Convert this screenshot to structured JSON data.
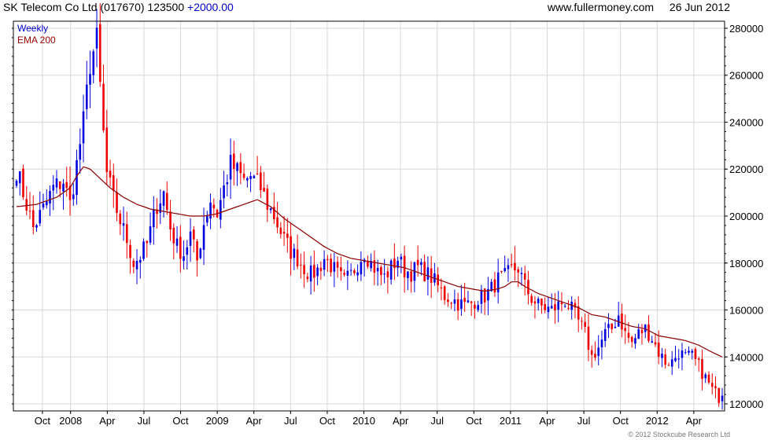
{
  "header": {
    "symbol": "SK Telecom Co Ltd (017670) 123500",
    "change": "+2000.00",
    "site": "www.fullermoney.com",
    "date": "26 Jun 2012"
  },
  "legend": {
    "series1": "Weekly",
    "series2": "EMA 200"
  },
  "copyright": "© 2012 Stockcube Research Ltd",
  "colors": {
    "up": "#0000dd",
    "down": "#ee0000",
    "ema": "#8b0000",
    "grid": "#d8d8d8"
  },
  "chart_data": {
    "type": "candlestick",
    "title": "SK Telecom Co Ltd (017670) 123500 +2000.00",
    "y_ticks": [
      "120000",
      "140000",
      "160000",
      "180000",
      "200000",
      "220000",
      "240000",
      "260000",
      "280000"
    ],
    "x_ticks": [
      "Oct",
      "2008",
      "Apr",
      "Jul",
      "Oct",
      "2009",
      "Apr",
      "Jul",
      "Oct",
      "2010",
      "Apr",
      "Jul",
      "Oct",
      "2011",
      "Apr",
      "Jul",
      "Oct",
      "2012",
      "Apr"
    ],
    "ylim": [
      117000,
      283000
    ],
    "grid": true,
    "legend_position": "top-left",
    "series": [
      {
        "name": "Weekly",
        "style": "candles",
        "keypoints_close": [
          [
            0,
            220000
          ],
          [
            3,
            205000
          ],
          [
            5,
            195000
          ],
          [
            8,
            203000
          ],
          [
            11,
            212000
          ],
          [
            14,
            215000
          ],
          [
            16,
            205000
          ],
          [
            18,
            222000
          ],
          [
            20,
            240000
          ],
          [
            22,
            265000
          ],
          [
            24,
            275000
          ],
          [
            26,
            235000
          ],
          [
            27,
            218000
          ],
          [
            29,
            207000
          ],
          [
            31,
            198000
          ],
          [
            33,
            190000
          ],
          [
            35,
            180000
          ],
          [
            37,
            183000
          ],
          [
            39,
            188000
          ],
          [
            42,
            205000
          ],
          [
            44,
            210000
          ],
          [
            46,
            195000
          ],
          [
            48,
            187000
          ],
          [
            50,
            184000
          ],
          [
            52,
            192000
          ],
          [
            54,
            181000
          ],
          [
            56,
            197000
          ],
          [
            58,
            207000
          ],
          [
            60,
            201000
          ],
          [
            62,
            212000
          ],
          [
            64,
            222000
          ],
          [
            66,
            219000
          ],
          [
            68,
            215000
          ],
          [
            70,
            217000
          ],
          [
            73,
            212000
          ],
          [
            75,
            205000
          ],
          [
            77,
            200000
          ],
          [
            80,
            190000
          ],
          [
            82,
            185000
          ],
          [
            84,
            182000
          ],
          [
            86,
            178000
          ],
          [
            88,
            175000
          ],
          [
            90,
            177000
          ],
          [
            92,
            182000
          ],
          [
            94,
            179000
          ],
          [
            96,
            175000
          ],
          [
            98,
            172000
          ],
          [
            100,
            175000
          ],
          [
            102,
            180000
          ],
          [
            104,
            185000
          ],
          [
            106,
            180000
          ],
          [
            108,
            176000
          ],
          [
            110,
            174000
          ],
          [
            112,
            178000
          ],
          [
            114,
            182000
          ],
          [
            116,
            177000
          ],
          [
            118,
            176000
          ],
          [
            120,
            178000
          ],
          [
            122,
            176000
          ],
          [
            124,
            174000
          ],
          [
            126,
            170000
          ],
          [
            128,
            166000
          ],
          [
            130,
            165000
          ],
          [
            132,
            163000
          ],
          [
            134,
            162000
          ],
          [
            136,
            163000
          ],
          [
            138,
            165000
          ],
          [
            140,
            166000
          ],
          [
            142,
            169000
          ],
          [
            144,
            173000
          ],
          [
            146,
            174000
          ],
          [
            148,
            177000
          ],
          [
            150,
            178000
          ],
          [
            152,
            170000
          ],
          [
            154,
            165000
          ],
          [
            156,
            162000
          ],
          [
            158,
            161000
          ],
          [
            160,
            160000
          ],
          [
            162,
            162000
          ],
          [
            164,
            164000
          ],
          [
            166,
            160000
          ],
          [
            168,
            155000
          ],
          [
            170,
            150000
          ],
          [
            172,
            140000
          ],
          [
            174,
            144000
          ],
          [
            176,
            150000
          ],
          [
            178,
            152000
          ],
          [
            180,
            158000
          ],
          [
            182,
            150000
          ],
          [
            184,
            146000
          ],
          [
            186,
            150000
          ],
          [
            188,
            152000
          ],
          [
            190,
            148000
          ],
          [
            192,
            142000
          ],
          [
            194,
            138000
          ],
          [
            196,
            138000
          ],
          [
            198,
            142000
          ],
          [
            200,
            140000
          ],
          [
            202,
            140000
          ],
          [
            204,
            136000
          ],
          [
            206,
            131000
          ],
          [
            208,
            126000
          ],
          [
            210,
            123000
          ],
          [
            211,
            123500
          ]
        ],
        "wick_percent": 4.0
      },
      {
        "name": "EMA 200",
        "style": "line",
        "keypoints": [
          [
            0,
            204000
          ],
          [
            6,
            205000
          ],
          [
            12,
            208000
          ],
          [
            16,
            212000
          ],
          [
            18,
            217000
          ],
          [
            20,
            221000
          ],
          [
            22,
            220000
          ],
          [
            25,
            216000
          ],
          [
            28,
            212000
          ],
          [
            32,
            208000
          ],
          [
            36,
            205000
          ],
          [
            40,
            203000
          ],
          [
            44,
            202000
          ],
          [
            48,
            201000
          ],
          [
            52,
            200000
          ],
          [
            56,
            200000
          ],
          [
            60,
            201000
          ],
          [
            64,
            203000
          ],
          [
            68,
            205000
          ],
          [
            72,
            207000
          ],
          [
            76,
            204000
          ],
          [
            80,
            199000
          ],
          [
            84,
            195000
          ],
          [
            88,
            191000
          ],
          [
            92,
            187000
          ],
          [
            96,
            184000
          ],
          [
            100,
            182000
          ],
          [
            104,
            181000
          ],
          [
            108,
            180000
          ],
          [
            112,
            179000
          ],
          [
            116,
            178000
          ],
          [
            120,
            176000
          ],
          [
            124,
            174000
          ],
          [
            128,
            172000
          ],
          [
            132,
            170000
          ],
          [
            136,
            169000
          ],
          [
            140,
            168000
          ],
          [
            144,
            169000
          ],
          [
            146,
            170000
          ],
          [
            148,
            172000
          ],
          [
            150,
            172000
          ],
          [
            152,
            170000
          ],
          [
            156,
            167000
          ],
          [
            160,
            165000
          ],
          [
            164,
            163000
          ],
          [
            168,
            161000
          ],
          [
            172,
            158000
          ],
          [
            176,
            157000
          ],
          [
            180,
            155000
          ],
          [
            184,
            153000
          ],
          [
            188,
            152000
          ],
          [
            192,
            149000
          ],
          [
            196,
            148000
          ],
          [
            200,
            147000
          ],
          [
            204,
            145000
          ],
          [
            208,
            142000
          ],
          [
            211,
            140000
          ]
        ]
      }
    ]
  }
}
